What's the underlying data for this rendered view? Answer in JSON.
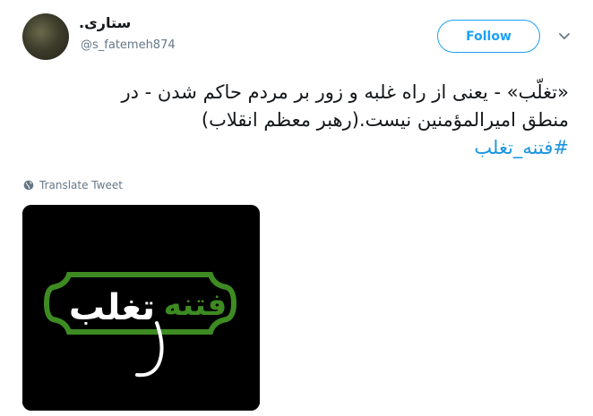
{
  "user": {
    "display_name": "ستاری.",
    "handle": "@s_fatemeh874"
  },
  "actions": {
    "follow_label": "Follow",
    "more_icon": "chevron-down-icon"
  },
  "tweet": {
    "text_line1": "«تغلّب» - یعنی از راه غلبه و زور بر مردم حاکم شدن - در",
    "text_line2": "منطق امیرالمؤمنین نیست.(رهبر معظم انقلاب)",
    "hashtag": "#فتنه_تغلب",
    "translate_label": "Translate Tweet"
  },
  "media": {
    "logo_text_green": "فتنه",
    "logo_text_white": "تغلب",
    "colors": {
      "background": "#000000",
      "frame": "#3d8b22",
      "green_text": "#3d8b22",
      "white_text": "#ffffff"
    }
  },
  "colors": {
    "accent": "#1da1f2",
    "hashtag": "#1b95e0",
    "muted": "#657786"
  }
}
